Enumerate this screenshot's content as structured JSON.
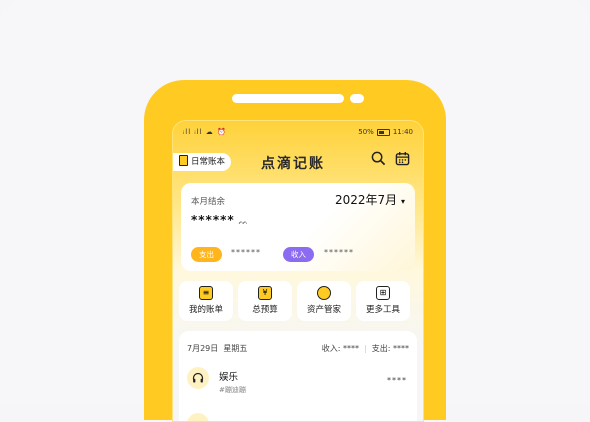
{
  "status_bar": {
    "signal": "ᵢll ᵢll ☁ ⏰",
    "battery": "50%",
    "time": "11:40"
  },
  "header": {
    "book_name": "日常账本",
    "app_title": "点滴记账"
  },
  "summary": {
    "label": "本月结余",
    "month": "2022年7月",
    "value": "******",
    "expense_label": "支出",
    "expense_value": "******",
    "income_label": "收入",
    "income_value": "******"
  },
  "tools": [
    {
      "label": "我的账单",
      "icon": "bill-icon"
    },
    {
      "label": "总预算",
      "icon": "budget-icon"
    },
    {
      "label": "资产管家",
      "icon": "asset-search-icon"
    },
    {
      "label": "更多工具",
      "icon": "grid-icon"
    }
  ],
  "records": {
    "date": "7月29日",
    "weekday": "星期五",
    "income_label": "收入:",
    "income_value": "****",
    "expense_label": "支出:",
    "expense_value": "****",
    "items": [
      {
        "category": "娱乐",
        "note": "#蹦迪蹦",
        "amount": "****",
        "icon": "headphones-icon"
      }
    ]
  },
  "colors": {
    "brand": "#ffcb22",
    "expense": "#ffb51e",
    "income": "#8b6cf0"
  }
}
